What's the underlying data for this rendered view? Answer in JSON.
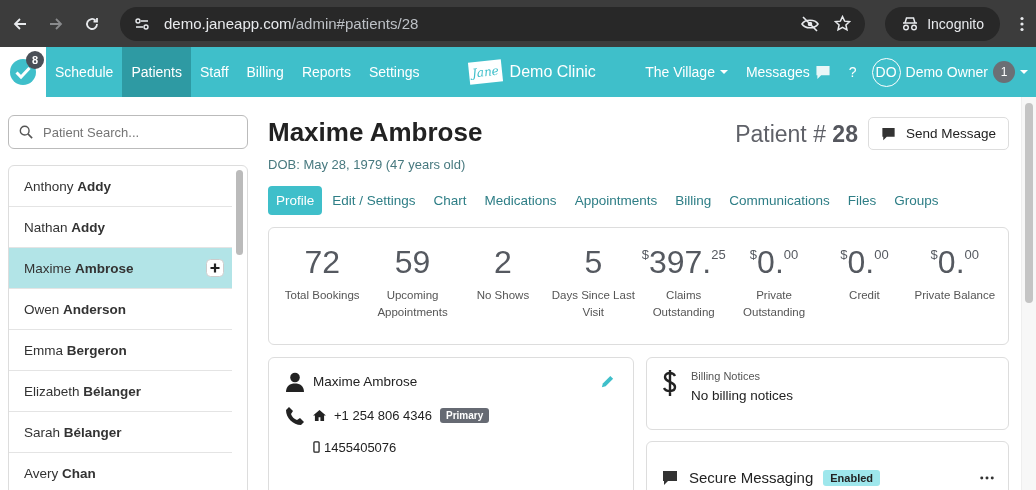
{
  "browser": {
    "url_host": "demo.janeapp.com",
    "url_path": "/admin#patients/28",
    "profile": "Incognito"
  },
  "nav": {
    "badge": "8",
    "items": [
      {
        "label": "Schedule",
        "selected": false
      },
      {
        "label": "Patients",
        "selected": true
      },
      {
        "label": "Staff",
        "selected": false
      },
      {
        "label": "Billing",
        "selected": false
      },
      {
        "label": "Reports",
        "selected": false
      },
      {
        "label": "Settings",
        "selected": false
      }
    ],
    "logo_text": "Jane",
    "clinic": "Demo Clinic",
    "location": "The Village",
    "messages": "Messages",
    "help": "?",
    "avatar": "DO",
    "user": "Demo Owner",
    "user_badge": "1"
  },
  "sidebar": {
    "search": {
      "placeholder": "Patient Search..."
    },
    "patients": [
      {
        "name": "Anthony **Addy**",
        "selected": false
      },
      {
        "name": "Nathan **Addy**",
        "selected": false
      },
      {
        "name": "Maxime **Ambrose**",
        "selected": true
      },
      {
        "name": "Owen **Anderson**",
        "selected": false
      },
      {
        "name": "Emma **Bergeron**",
        "selected": false
      },
      {
        "name": "Elizabeth **Bélanger**",
        "selected": false
      },
      {
        "name": "Sarah **Bélanger**",
        "selected": false
      },
      {
        "name": "Avery **Chan**",
        "selected": false
      }
    ]
  },
  "patient": {
    "name": "Maxime Ambrose",
    "dob": "DOB: May 28, 1979 (47 years old)",
    "number_label": "Patient #",
    "number": "28",
    "send_button": "Send Message"
  },
  "tabs": [
    {
      "label": "Profile",
      "selected": true
    },
    {
      "label": "Edit / Settings",
      "selected": false
    },
    {
      "label": "Chart",
      "selected": false
    },
    {
      "label": "Medications",
      "selected": false
    },
    {
      "label": "Appointments",
      "selected": false
    },
    {
      "label": "Billing",
      "selected": false
    },
    {
      "label": "Communications",
      "selected": false
    },
    {
      "label": "Files",
      "selected": false
    },
    {
      "label": "Groups",
      "selected": false
    }
  ],
  "stats": [
    {
      "kind": "count",
      "value": "72",
      "label": "Total Bookings"
    },
    {
      "kind": "count",
      "value": "59",
      "label": "Upcoming Appointments"
    },
    {
      "kind": "count",
      "value": "2",
      "label": "No Shows"
    },
    {
      "kind": "count",
      "value": "5",
      "label": "Days Since Last Visit"
    },
    {
      "kind": "money",
      "currency": "$",
      "value": "397.",
      "cents": "25",
      "label": "Claims Outstanding"
    },
    {
      "kind": "money",
      "currency": "$",
      "value": "0.",
      "cents": "00",
      "label": "Private Outstanding"
    },
    {
      "kind": "money",
      "currency": "$",
      "value": "0.",
      "cents": "00",
      "label": "Credit"
    },
    {
      "kind": "money",
      "currency": "$",
      "value": "0.",
      "cents": "00",
      "label": "Private Balance"
    }
  ],
  "contact": {
    "name": "Maxime Ambrose",
    "home_phone": "+1 254 806 4346",
    "primary_badge": "Primary",
    "mobile_phone": "1455405076"
  },
  "billing_notices": {
    "title": "Billing Notices",
    "text": "No billing notices"
  },
  "secure_messaging": {
    "title": "Secure Messaging",
    "badge": "Enabled"
  }
}
